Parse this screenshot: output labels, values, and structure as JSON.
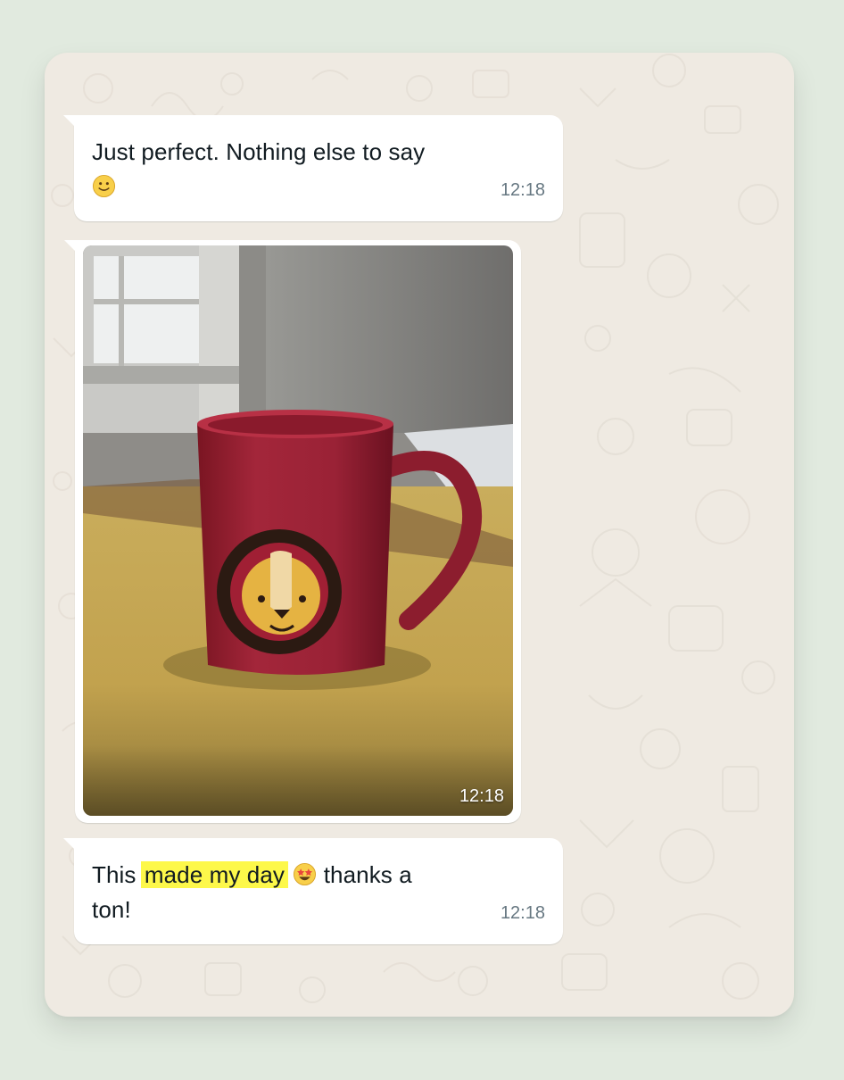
{
  "messages": [
    {
      "type": "text",
      "text": "Just perfect. Nothing else to say",
      "emoji": "slightly-smiling-face-emoji",
      "time": "12:18"
    },
    {
      "type": "image",
      "image_description_name": "red-mug-lion-photo",
      "time": "12:18"
    },
    {
      "type": "text",
      "text_before": "This",
      "highlight": "made my day",
      "emoji": "star-struck-emoji",
      "text_after": "thanks a ton!",
      "highlight_color": "#fdf84a",
      "time": "12:18"
    }
  ],
  "colors": {
    "page_background": "#e1eadf",
    "chat_background": "#efeae2",
    "bubble": "#ffffff",
    "text": "#111b21",
    "timestamp": "#667781"
  }
}
